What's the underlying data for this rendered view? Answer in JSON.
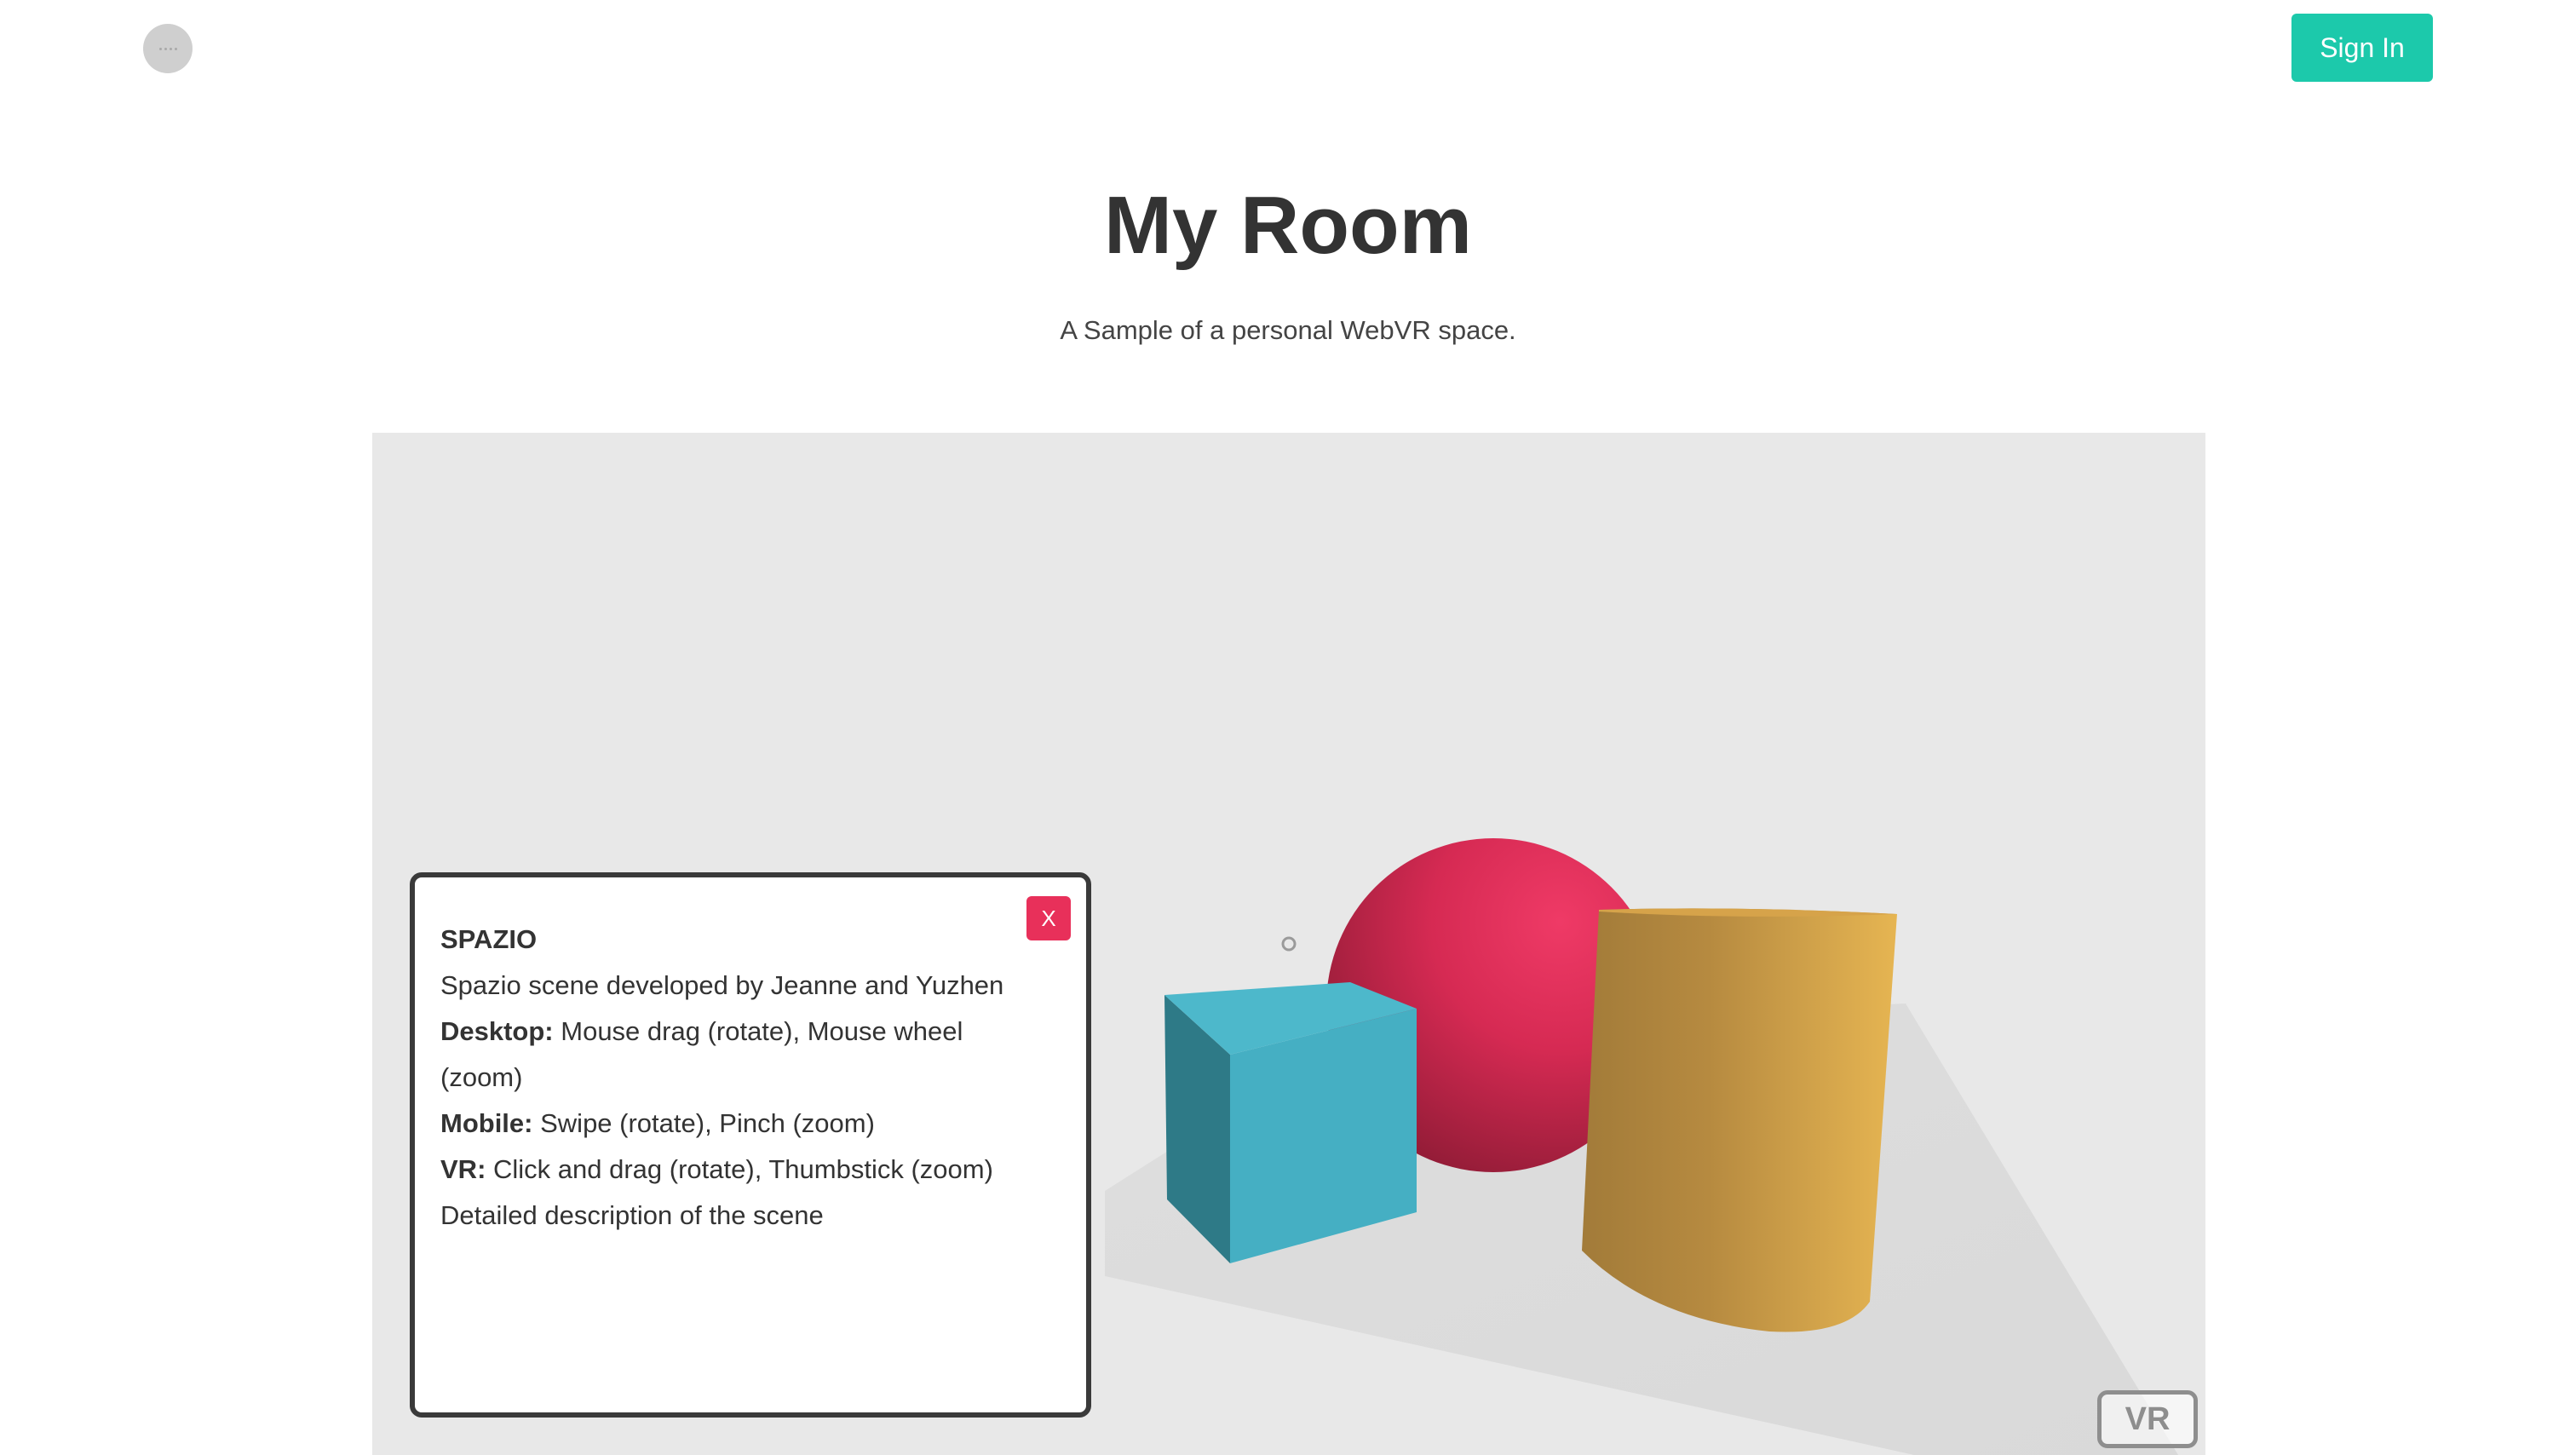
{
  "header": {
    "logo_icon": "placeholder-logo-icon",
    "signin_label": "Sign In"
  },
  "hero": {
    "title": "My Room",
    "subtitle": "A Sample of a personal WebVR space."
  },
  "info_panel": {
    "title": "SPAZIO",
    "credits": "Spazio scene developed by Jeanne and Yuzhen",
    "desktop_label": "Desktop:",
    "desktop_text": " Mouse drag (rotate), Mouse wheel",
    "desktop_text_cont": "(zoom)",
    "mobile_label": "Mobile:",
    "mobile_text": " Swipe (rotate), Pinch (zoom)",
    "vr_label": "VR:",
    "vr_text": " Click and drag (rotate), Thumbstick (zoom)",
    "description": "Detailed description of the scene",
    "close_label": "X"
  },
  "scene": {
    "background_color": "#e8e8e8",
    "objects": [
      "sphere",
      "cube",
      "cylinder"
    ],
    "colors": {
      "sphere": "#e02a55",
      "cube": "#45afc3",
      "cylinder": "#d9a546",
      "floor": "#dcdcdc"
    }
  },
  "vr_button_label": "VR",
  "colors": {
    "accent": "#1cc9ab",
    "close": "#e8305a"
  }
}
